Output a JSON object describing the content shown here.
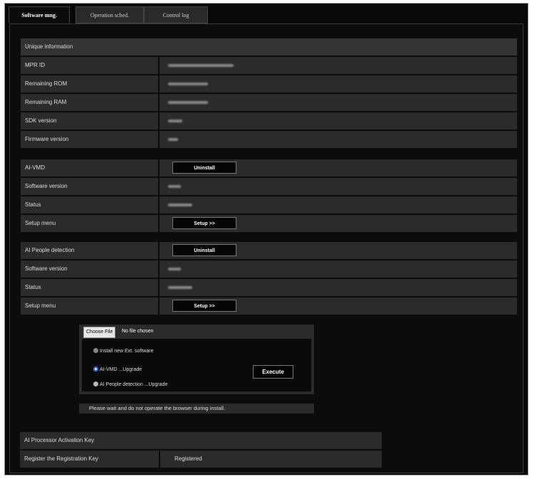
{
  "tabs": [
    {
      "label": "Software mng.",
      "active": true
    },
    {
      "label": "Operation sched.",
      "active": false
    },
    {
      "label": "Control log",
      "active": false
    }
  ],
  "unique_info": {
    "header": "Unique information",
    "rows": [
      {
        "label": "MPR ID"
      },
      {
        "label": "Remaining ROM"
      },
      {
        "label": "Remaining RAM"
      },
      {
        "label": "SDK version"
      },
      {
        "label": "Firmware version"
      }
    ]
  },
  "ai_vmd": {
    "header": "AI-VMD",
    "uninstall_label": "Uninstall",
    "software_version_label": "Software version",
    "status_label": "Status",
    "setup_menu_label": "Setup menu",
    "setup_button_label": "Setup >>"
  },
  "ai_people": {
    "header": "AI People detection",
    "uninstall_label": "Uninstall",
    "software_version_label": "Software version",
    "status_label": "Status",
    "setup_menu_label": "Setup menu",
    "setup_button_label": "Setup >>"
  },
  "install": {
    "choose_file_label": "Choose File",
    "no_file_text": "No file chosen",
    "options": [
      {
        "label": "Install new Ext. software",
        "selected": false
      },
      {
        "label": "AI-VMD ...Upgrade",
        "selected": true
      },
      {
        "label": "AI People detection ...Upgrade",
        "selected": false
      }
    ],
    "execute_label": "Execute",
    "wait_message": "Please wait and do not operate the browser during install."
  },
  "activation": {
    "header": "AI Processor Activation Key",
    "register_label": "Register the Registration Key",
    "register_value": "Registered"
  }
}
